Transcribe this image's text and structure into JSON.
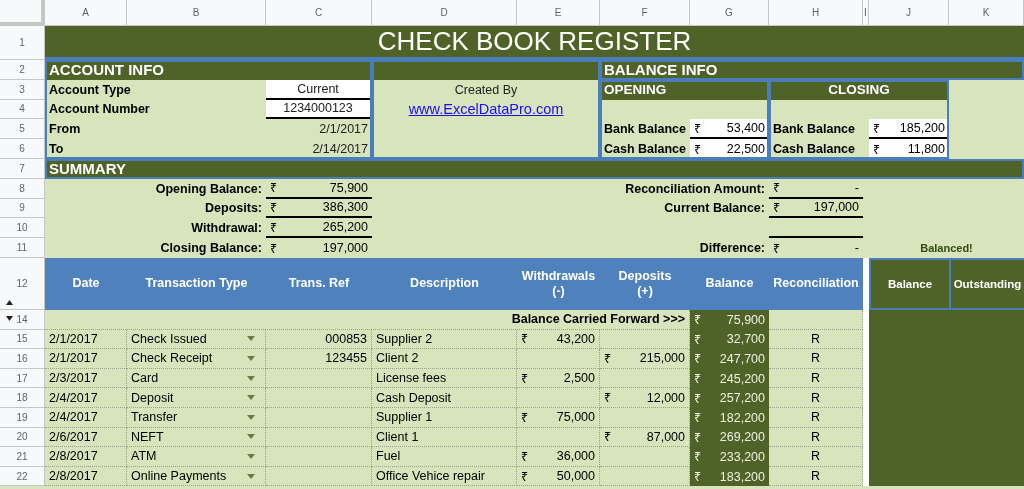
{
  "column_letters": [
    "A",
    "B",
    "C",
    "D",
    "E",
    "F",
    "G",
    "H",
    "I",
    "J",
    "K"
  ],
  "row_numbers": [
    {
      "label": "1",
      "kind": "plain"
    },
    {
      "label": "2",
      "kind": "plain"
    },
    {
      "label": "3",
      "kind": "plain"
    },
    {
      "label": "4",
      "kind": "plain"
    },
    {
      "label": "5",
      "kind": "plain"
    },
    {
      "label": "6",
      "kind": "plain"
    },
    {
      "label": "7",
      "kind": "plain"
    },
    {
      "label": "8",
      "kind": "plain"
    },
    {
      "label": "9",
      "kind": "plain"
    },
    {
      "label": "10",
      "kind": "plain"
    },
    {
      "label": "11",
      "kind": "plain"
    },
    {
      "label": "12",
      "kind": "collapse"
    },
    {
      "label": "14",
      "kind": "expand"
    },
    {
      "label": "15",
      "kind": "plain"
    },
    {
      "label": "16",
      "kind": "plain"
    },
    {
      "label": "17",
      "kind": "plain"
    },
    {
      "label": "18",
      "kind": "plain"
    },
    {
      "label": "19",
      "kind": "plain"
    },
    {
      "label": "20",
      "kind": "plain"
    },
    {
      "label": "21",
      "kind": "plain"
    },
    {
      "label": "22",
      "kind": "plain"
    }
  ],
  "title": "CHECK BOOK REGISTER",
  "account_info": {
    "heading": "ACCOUNT INFO",
    "fields": [
      {
        "label": "Account Type",
        "value": "Current",
        "kind": "input"
      },
      {
        "label": "Account Number",
        "value": "1234000123",
        "kind": "input"
      },
      {
        "label": "From",
        "value": "2/1/2017",
        "kind": "plain"
      },
      {
        "label": "To",
        "value": "2/14/2017",
        "kind": "plain"
      }
    ]
  },
  "credit": {
    "label": "Created By",
    "link": "www.ExcelDataPro.com"
  },
  "balance_info": {
    "heading": "BALANCE INFO",
    "opening": {
      "heading": "OPENING",
      "rows": [
        {
          "label": "Bank Balance",
          "currency": "₹",
          "amount": "53,400"
        },
        {
          "label": "Cash Balance",
          "currency": "₹",
          "amount": "22,500"
        }
      ]
    },
    "closing": {
      "heading": "CLOSING",
      "rows": [
        {
          "label": "Bank Balance",
          "currency": "₹",
          "amount": "185,200"
        },
        {
          "label": "Cash Balance",
          "currency": "₹",
          "amount": "11,800"
        }
      ]
    }
  },
  "summary": {
    "heading": "SUMMARY",
    "left": [
      {
        "label": "Opening Balance:",
        "currency": "₹",
        "amount": "75,900"
      },
      {
        "label": "Deposits:",
        "currency": "₹",
        "amount": "386,300"
      },
      {
        "label": "Withdrawal:",
        "currency": "₹",
        "amount": "265,200"
      },
      {
        "label": "Closing Balance:",
        "currency": "₹",
        "amount": "197,000"
      }
    ],
    "right": [
      {
        "label": "Reconciliation Amount:",
        "currency": "₹",
        "amount": "-"
      },
      {
        "label": "Current Balance:",
        "currency": "₹",
        "amount": "197,000"
      },
      {
        "label": "Difference:",
        "currency": "₹",
        "amount": "-"
      }
    ],
    "status": "Balanced!"
  },
  "table": {
    "columns": [
      "Date",
      "Transaction Type",
      "Trans. Ref",
      "Description",
      "Withdrawals\n(-)",
      "Deposits\n(+)",
      "Balance",
      "Reconciliation"
    ],
    "side_columns": [
      "Balance",
      "Outstanding"
    ],
    "carried_forward": {
      "label": "Balance Carried Forward >>>",
      "currency": "₹",
      "amount": "75,900"
    },
    "rows": [
      {
        "date": "2/1/2017",
        "type": "Check Issued",
        "ref": "000853",
        "description": "Supplier 2",
        "withdrawal": {
          "currency": "₹",
          "amount": "43,200"
        },
        "balance": {
          "currency": "₹",
          "amount": "32,700"
        },
        "reconciliation": "R"
      },
      {
        "date": "2/1/2017",
        "type": "Check Receipt",
        "ref": "123455",
        "description": "Client 2",
        "deposit": {
          "currency": "₹",
          "amount": "215,000"
        },
        "balance": {
          "currency": "₹",
          "amount": "247,700"
        },
        "reconciliation": "R"
      },
      {
        "date": "2/3/2017",
        "type": "Card",
        "description": "License fees",
        "withdrawal": {
          "currency": "₹",
          "amount": "2,500"
        },
        "balance": {
          "currency": "₹",
          "amount": "245,200"
        },
        "reconciliation": "R"
      },
      {
        "date": "2/4/2017",
        "type": "Deposit",
        "description": "Cash Deposit",
        "deposit": {
          "currency": "₹",
          "amount": "12,000"
        },
        "balance": {
          "currency": "₹",
          "amount": "257,200"
        },
        "reconciliation": "R"
      },
      {
        "date": "2/4/2017",
        "type": "Transfer",
        "description": "Supplier 1",
        "withdrawal": {
          "currency": "₹",
          "amount": "75,000"
        },
        "balance": {
          "currency": "₹",
          "amount": "182,200"
        },
        "reconciliation": "R"
      },
      {
        "date": "2/6/2017",
        "type": "NEFT",
        "description": "Client 1",
        "deposit": {
          "currency": "₹",
          "amount": "87,000"
        },
        "balance": {
          "currency": "₹",
          "amount": "269,200"
        },
        "reconciliation": "R"
      },
      {
        "date": "2/8/2017",
        "type": "ATM",
        "description": "Fuel",
        "withdrawal": {
          "currency": "₹",
          "amount": "36,000"
        },
        "balance": {
          "currency": "₹",
          "amount": "233,200"
        },
        "reconciliation": "R"
      },
      {
        "date": "2/8/2017",
        "type": "Online Payments",
        "description": "Office Vehice repair",
        "withdrawal": {
          "currency": "₹",
          "amount": "50,000"
        },
        "balance": {
          "currency": "₹",
          "amount": "183,200"
        },
        "reconciliation": "R"
      }
    ]
  }
}
